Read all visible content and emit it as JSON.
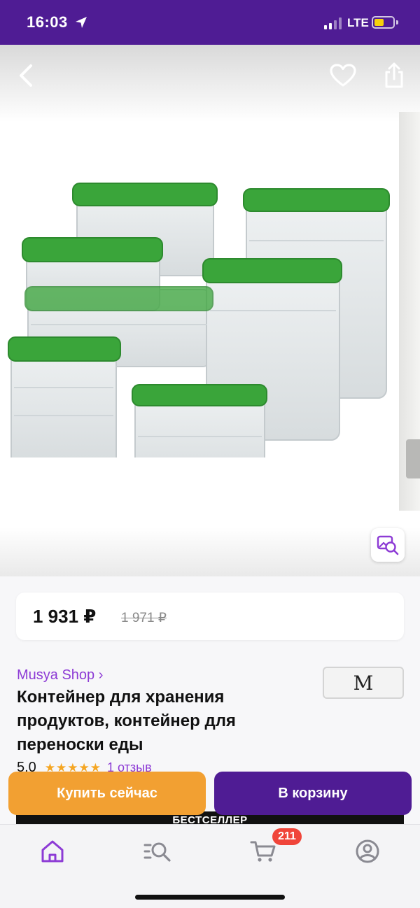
{
  "status_bar": {
    "time": "16:03",
    "network": "LTE"
  },
  "header": {
    "back_icon": "chevron-left-icon",
    "favorite_icon": "heart-outline-icon",
    "share_icon": "share-icon"
  },
  "gallery": {
    "image_search_icon": "image-search-icon"
  },
  "price": {
    "current": "1 931 ₽",
    "old": "1 971 ₽"
  },
  "shop": {
    "name": "Musya Shop ›",
    "logo_letter": "M"
  },
  "product": {
    "title": "Контейнер для хранения продуктов, контейнер для переноски еды",
    "rating": "5.0",
    "stars": "★★★★★",
    "reviews": "1 отзыв",
    "badge": "БЕСТСЕЛЛЕР"
  },
  "actions": {
    "buy_now": "Купить сейчас",
    "add_to_cart": "В корзину"
  },
  "tab_bar": {
    "items": [
      {
        "icon": "home-icon",
        "active": true
      },
      {
        "icon": "catalog-search-icon",
        "active": false
      },
      {
        "icon": "cart-icon",
        "active": false
      },
      {
        "icon": "profile-icon",
        "active": false
      }
    ],
    "cart_count": "211"
  },
  "colors": {
    "brand": "#4f1c94",
    "accent": "#8d3bd5",
    "buy_now": "#f2a032",
    "badge": "#f0453a",
    "lid_green": "#3aa53a"
  }
}
